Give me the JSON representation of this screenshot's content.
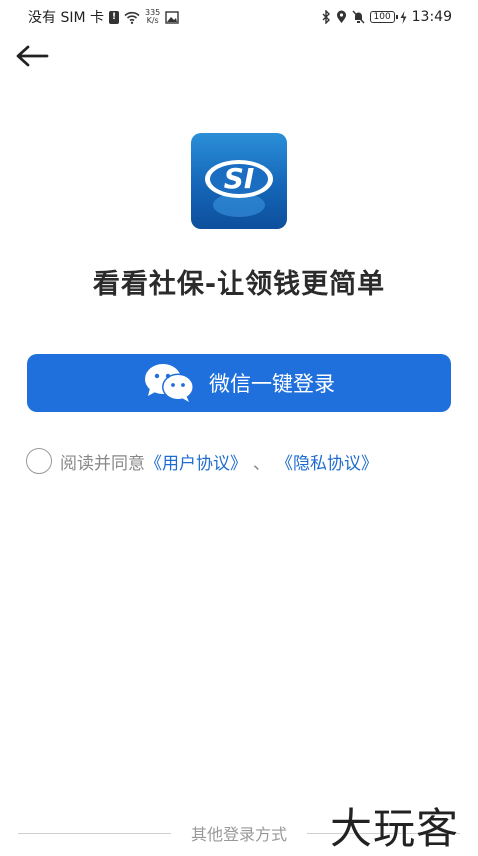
{
  "status_bar": {
    "carrier": "没有 SIM 卡",
    "speed_value": "335",
    "speed_unit": "K/s",
    "battery": "100",
    "time": "13:49"
  },
  "header": {
    "back_icon": "arrow-left-icon"
  },
  "logo": {
    "text": "SI"
  },
  "slogan": "看看社保-让领钱更简单",
  "login": {
    "wechat_button_label": "微信一键登录",
    "wechat_icon": "wechat-icon"
  },
  "agreement": {
    "prefix": "阅读并同意",
    "user_agreement": "《用户协议》",
    "separator": "、",
    "privacy_policy": "《隐私协议》"
  },
  "other_login": {
    "label": "其他登录方式"
  },
  "watermark": "大玩客",
  "colors": {
    "primary": "#1f70dc",
    "link": "#1f6cd0"
  }
}
